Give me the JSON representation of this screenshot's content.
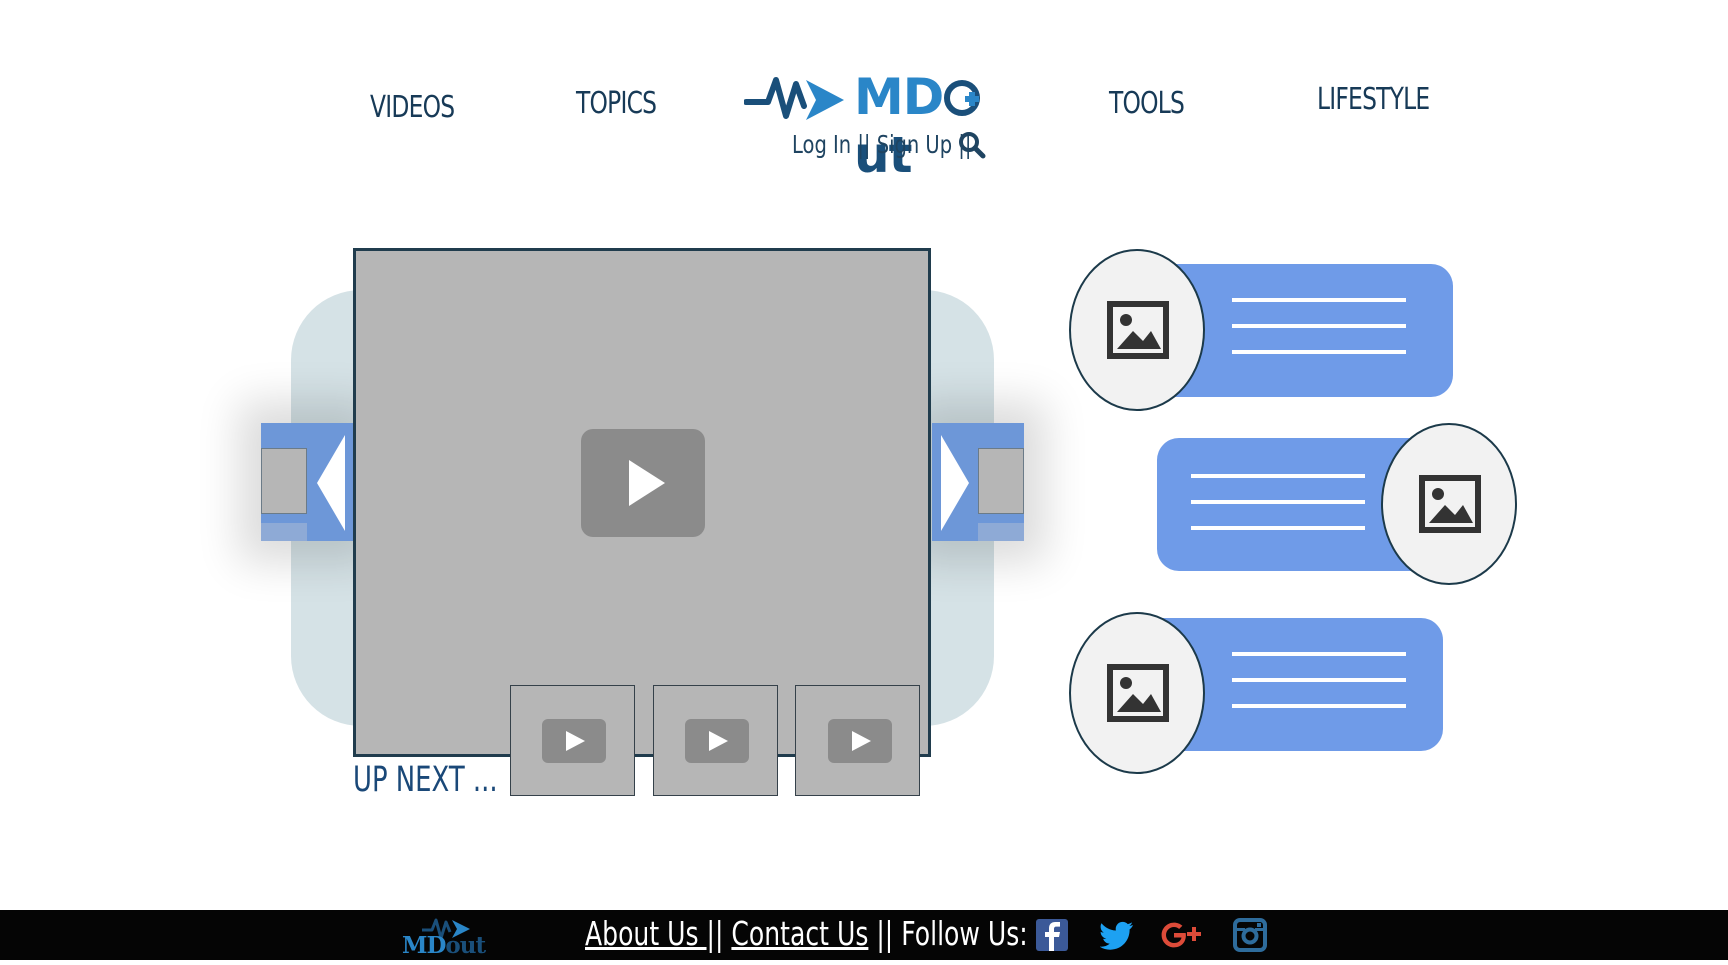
{
  "nav": {
    "videos": "VIDEOS",
    "topics": "TOPICS",
    "tools": "TOOLS",
    "lifestyle": "LIFESTYLE"
  },
  "brand": {
    "name_part1": "MD",
    "name_part2": "ut",
    "color_primary": "#2a86c8",
    "color_dark": "#1a4f7a"
  },
  "auth": {
    "login": "Log In",
    "separator": " || ",
    "signup": "Sign Up",
    "trailing_separator": " ||"
  },
  "carousel": {
    "up_next": "UP NEXT ...",
    "thumbnail_count": 3
  },
  "articles": [
    {
      "icon": "image-icon",
      "side": "left"
    },
    {
      "icon": "image-icon",
      "side": "right"
    },
    {
      "icon": "image-icon",
      "side": "left"
    }
  ],
  "footer": {
    "about": "About Us ",
    "sep1": "|| ",
    "contact": "Contact Us",
    "follow": " || Follow Us:",
    "social": [
      "facebook-icon",
      "twitter-icon",
      "google-plus-icon",
      "instagram-icon"
    ]
  },
  "colors": {
    "accent_blue": "#6f9be8",
    "video_gray": "#b6b6b6",
    "carousel_bg": "#d5e2e6"
  }
}
